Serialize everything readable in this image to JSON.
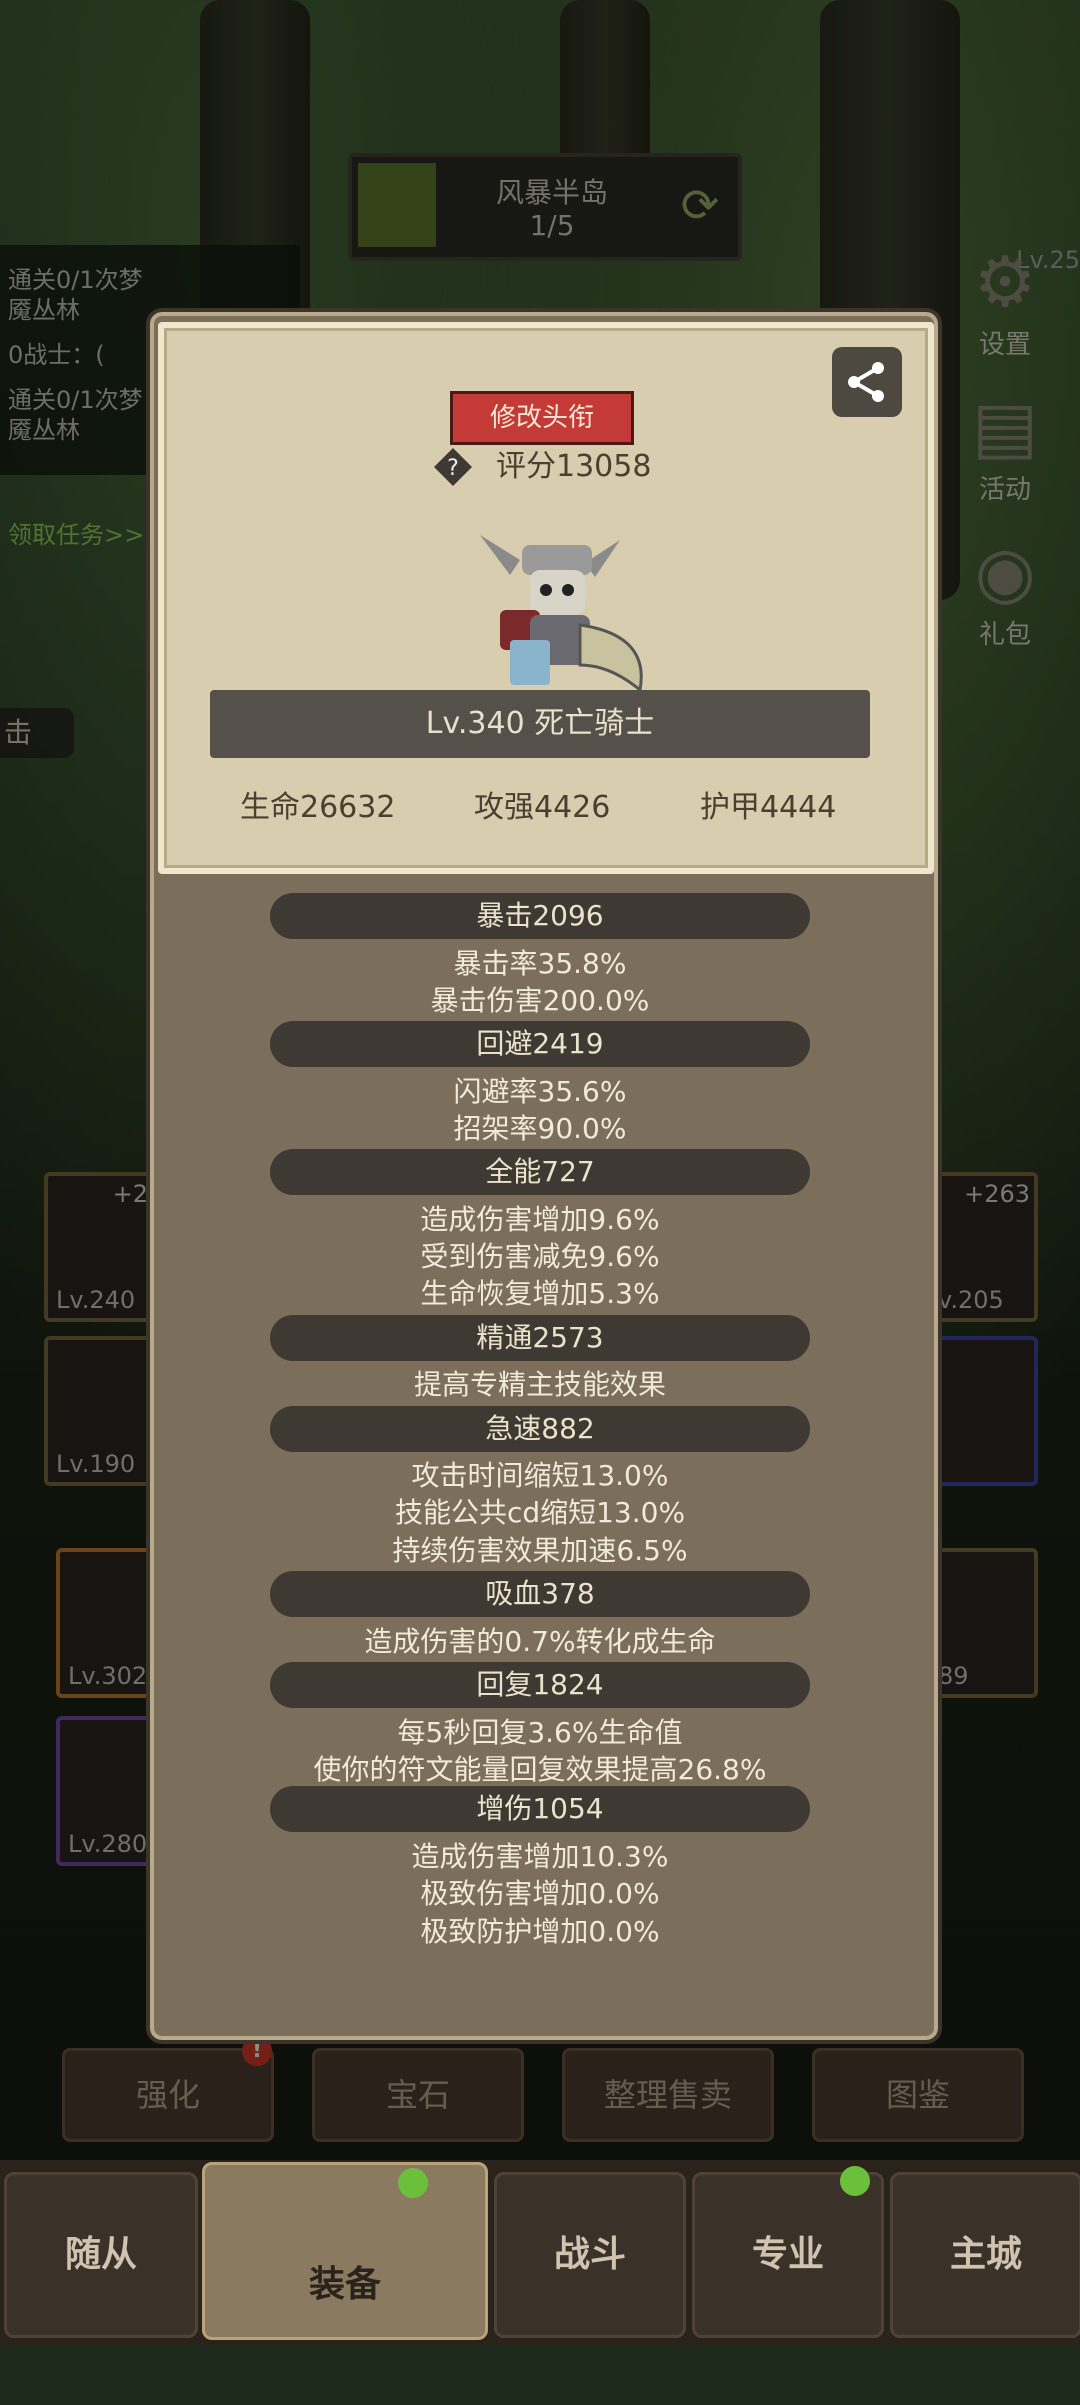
{
  "stage": {
    "name": "风暴半岛",
    "progress": "1/5"
  },
  "quest": {
    "lines": [
      "通关0/1次梦",
      "魇丛林",
      "0战士：(",
      "通关0/1次梦",
      "魇丛林"
    ],
    "claim": "领取任务>>"
  },
  "side_label": "击",
  "right_menu": {
    "level": "Lv.25",
    "settings": "设置",
    "activity": "活动",
    "gift": "礼包"
  },
  "bg_slots": {
    "left_top": "Lv.240",
    "left_top_plus": "+2",
    "right_top": "v.205",
    "right_top_plus": "+263",
    "left_mid": "Lv.190",
    "left_low": "Lv.302",
    "right_low": "89",
    "left_ring": "Lv.280"
  },
  "modal": {
    "rename_label": "修改头衔",
    "score_label": "评分13058",
    "hero_name": "Lv.340 死亡骑士",
    "base_stats": {
      "hp": "生命26632",
      "atk": "攻强4426",
      "armor": "护甲4444"
    },
    "groups": [
      {
        "title": "暴击2096",
        "lines": [
          "暴击率35.8%",
          "暴击伤害200.0%"
        ]
      },
      {
        "title": "回避2419",
        "lines": [
          "闪避率35.6%",
          "招架率90.0%"
        ]
      },
      {
        "title": "全能727",
        "lines": [
          "造成伤害增加9.6%",
          "受到伤害减免9.6%",
          "生命恢复增加5.3%"
        ]
      },
      {
        "title": "精通2573",
        "lines": [
          "提高专精主技能效果"
        ]
      },
      {
        "title": "急速882",
        "lines": [
          "攻击时间缩短13.0%",
          "技能公共cd缩短13.0%",
          "持续伤害效果加速6.5%"
        ]
      },
      {
        "title": "吸血378",
        "lines": [
          "造成伤害的0.7%转化成生命"
        ]
      },
      {
        "title": "回复1824",
        "lines": [
          "每5秒回复3.6%生命值",
          "使你的符文能量回复效果提高26.8%"
        ]
      },
      {
        "title": "增伤1054",
        "lines": [
          "造成伤害增加10.3%",
          "极致伤害增加0.0%",
          "极致防护增加0.0%"
        ]
      }
    ]
  },
  "bottom_buttons": [
    "强化",
    "宝石",
    "整理售卖",
    "图鉴"
  ],
  "nav": [
    "随从",
    "装备",
    "战斗",
    "专业",
    "主城"
  ],
  "colors": {
    "rename_bg": "#c43a36",
    "stat_bar": "#3e3a33",
    "card_bg": "#d9cdb0"
  }
}
